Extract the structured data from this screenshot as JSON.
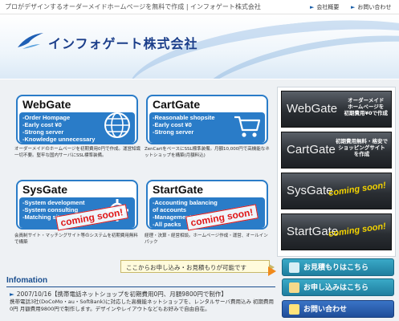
{
  "top_bar": {
    "tagline": "プロがデザインするオーダーメイドホームページを無料で作成 | インフォゲート株式会社",
    "links": [
      "会社概要",
      "お問い合わせ"
    ]
  },
  "header": {
    "logo_text": "インフォゲート株式会社"
  },
  "services": [
    {
      "name": "WebGate",
      "features": [
        "-Order Hompage",
        "-Early cost ¥0",
        "-Strong server",
        "-Knowledge unnecessary"
      ],
      "desc": "オーダーメイドのホームページを初期費用0円で作成。運営知識一切不要。堅牢な国内サーバにSSL標準装備。"
    },
    {
      "name": "CartGate",
      "features": [
        "-Reasonable shopsite",
        "-Early cost ¥0",
        "-Strong server"
      ],
      "desc": "ZenCartをベースにSSL標準装備。月額10,000円で高機能なネットショップを構築(月額料込)"
    },
    {
      "name": "SysGate",
      "features": [
        "-System development",
        "-System consulting",
        "-Matching site"
      ],
      "desc": "会員制サイト・マッチングサイト等のシステムを初期費用無料で構築",
      "stamp": "coming soon!"
    },
    {
      "name": "StartGate",
      "features": [
        "-Accounting balancing",
        "  of accounts",
        "-Management consulting",
        "-All packs"
      ],
      "desc": "経理・決算・経営相談。ホームページ作成・運営、オールインパック",
      "stamp": "coming soon!"
    }
  ],
  "banners": [
    {
      "title": "WebGate",
      "subtitle": [
        "オーダーメイド",
        "ホームページを",
        "初期費用¥0で作成"
      ]
    },
    {
      "title": "CartGate",
      "subtitle": [
        "初期費用無料・格安で",
        "ショッピングサイト",
        "を作成"
      ]
    },
    {
      "title": "SysGate",
      "soon": "coming soon!"
    },
    {
      "title": "StartGate",
      "soon": "coming soon!"
    }
  ],
  "cta": {
    "balloon": "ここからお申し込み・お見積もりが可能です",
    "estimate": "お見積もりはこちら",
    "apply": "お申し込みはこちら",
    "contact": "お問い合わせ"
  },
  "info": {
    "title": "Infomation",
    "headline": "2007/10/16【携帯電話ネットショップを初期費用0円、月額9800円で制作】",
    "body": "携帯電話3社(DoCoMo・au・SoftBank)に対応した高機能ネットショップを、レンタルサーバ費用込み 初期費用0円 月額費用9800円で制作します。デザインやレイアウトなどもお好みで自由自在。"
  },
  "colors": {
    "accent": "#2a7cc8",
    "stamp": "#e01818",
    "cta_teal": "#1f7e9f",
    "cta_blue": "#1f4d99"
  }
}
